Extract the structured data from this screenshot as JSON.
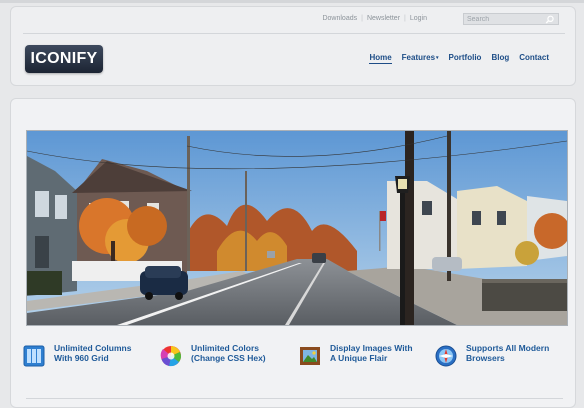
{
  "util_links": [
    "Downloads",
    "Newsletter",
    "Login"
  ],
  "search": {
    "placeholder": "Search"
  },
  "logo": {
    "text": "ICONIFY"
  },
  "nav": {
    "items": [
      {
        "label": "Home"
      },
      {
        "label": "Features"
      },
      {
        "label": "Portfolio"
      },
      {
        "label": "Blog"
      },
      {
        "label": "Contact"
      }
    ]
  },
  "features": [
    {
      "line1": "Unlimited Columns",
      "line2": "With 960 Grid",
      "icon": "grid-columns-icon"
    },
    {
      "line1": "Unlimited Colors",
      "line2": "(Change CSS Hex)",
      "icon": "color-wheel-icon"
    },
    {
      "line1": "Display Images With",
      "line2": "A Unique Flair",
      "icon": "framed-picture-icon"
    },
    {
      "line1": "Supports All Modern",
      "line2": "Browsers",
      "icon": "globe-browser-icon"
    }
  ],
  "colors": {
    "accent": "#1d4d87",
    "feature_text": "#1f5a99",
    "logo_bg": "#2b3546"
  }
}
